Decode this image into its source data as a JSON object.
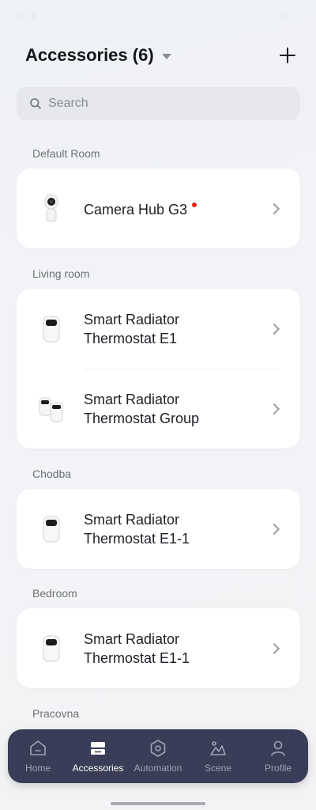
{
  "header": {
    "title": "Accessories (6)"
  },
  "search": {
    "placeholder": "Search"
  },
  "sections": [
    {
      "label": "Default Room",
      "devices": [
        {
          "name": "Camera Hub G3",
          "icon": "camera-hub-icon",
          "has_alert": true
        }
      ]
    },
    {
      "label": "Living room",
      "devices": [
        {
          "name": "Smart Radiator Thermostat E1",
          "icon": "thermostat-icon"
        },
        {
          "name": "Smart Radiator Thermostat Group",
          "icon": "thermostat-group-icon"
        }
      ]
    },
    {
      "label": "Chodba",
      "devices": [
        {
          "name": "Smart Radiator Thermostat E1-1",
          "icon": "thermostat-icon"
        }
      ]
    },
    {
      "label": "Bedroom",
      "devices": [
        {
          "name": "Smart Radiator Thermostat E1-1",
          "icon": "thermostat-icon"
        }
      ]
    },
    {
      "label": "Pracovna",
      "devices": []
    }
  ],
  "tabbar": {
    "tabs": [
      {
        "label": "Home",
        "icon": "home-icon",
        "active": false
      },
      {
        "label": "Accessories",
        "icon": "accessories-icon",
        "active": true
      },
      {
        "label": "Automation",
        "icon": "automation-icon",
        "active": false
      },
      {
        "label": "Scene",
        "icon": "scene-icon",
        "active": false
      },
      {
        "label": "Profile",
        "icon": "profile-icon",
        "active": false
      }
    ]
  },
  "colors": {
    "tabbar_bg": "#3a3d57",
    "active_tab": "#ffffff",
    "inactive_tab": "#9fa2b4",
    "alert_dot": "#e2231a"
  }
}
